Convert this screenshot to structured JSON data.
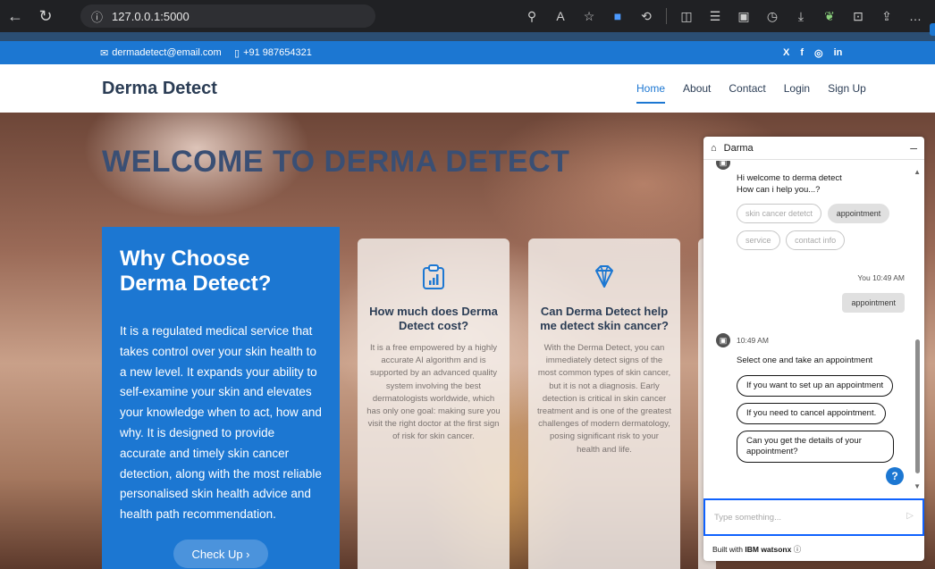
{
  "browser": {
    "url": "127.0.0.1:5000",
    "back_icon": "arrow-left-icon",
    "refresh_icon": "refresh-icon"
  },
  "topbar": {
    "email": "dermadetect@email.com",
    "phone": "+91 987654321",
    "socials": [
      "X",
      "f",
      "◎",
      "in"
    ]
  },
  "header": {
    "brand": "Derma Detect",
    "nav": [
      "Home",
      "About",
      "Contact",
      "Login",
      "Sign Up"
    ]
  },
  "hero": {
    "title": "WELCOME TO DERMA DETECT",
    "why": {
      "heading": "Why Choose Derma Detect?",
      "body": "It is a regulated medical service that takes control over your skin health to a new level. It expands your ability to self-examine your skin and elevates your knowledge when to act, how and why. It is designed to provide accurate and timely skin cancer detection, along with the most reliable personalised skin health advice and health path recommendation.",
      "button": "Check Up ›"
    },
    "cards": [
      {
        "title": "How much does Derma Detect cost?",
        "body": "It is a free empowered by a highly accurate AI algorithm and is supported by an advanced quality system involving the best dermatologists worldwide, which has only one goal: making sure you visit the right doctor at the first sign of risk for skin cancer."
      },
      {
        "title": "Can Derma Detect help me detect skin cancer?",
        "body": "With the Derma Detect, you can immediately detect signs of the most common types of skin cancer, but it is not a diagnosis. Early detection is critical in skin cancer treatment and is one of the greatest challenges of modern dermatology, posing significant risk to your health and life."
      }
    ]
  },
  "chat": {
    "title": "Darma",
    "welcome_line1": "Hi welcome to derma detect",
    "welcome_line2": "How can i help you...?",
    "chips": [
      "skin cancer detetct",
      "appointment",
      "service",
      "contact info"
    ],
    "user_meta": "You 10:49 AM",
    "user_message": "appointment",
    "bot_time": "10:49 AM",
    "bot_prompt": "Select one and take an appointment",
    "options": [
      "If you want to set up an appointment",
      "If you need to cancel appointment.",
      "Can you get the details of your appointment?"
    ],
    "help": "?",
    "input_placeholder": "Type something...",
    "footer_prefix": "Built with ",
    "footer_brand": "IBM watsonx",
    "footer_info": "ⓘ"
  },
  "colors": {
    "primary": "#1c77d2",
    "brand_text": "#2b3d55"
  }
}
